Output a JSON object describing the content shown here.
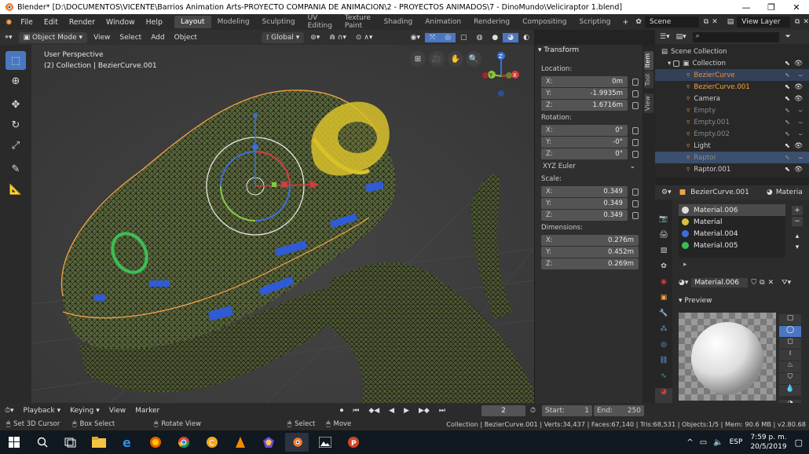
{
  "window": {
    "title": "Blender* [D:\\DOCUMENTOS\\VICENTE\\Barrios Animation Arts-PROYECTO COMPAÑIA DE ANIMACION\\2 - PROYECTOS ANIMADOS\\7 - DinoMundo\\Veliciraptor 1.blend]",
    "minimize": "—",
    "maximize": "❐",
    "close": "✕"
  },
  "menubar": {
    "items": [
      "File",
      "Edit",
      "Render",
      "Window",
      "Help"
    ],
    "workspaces": [
      "Layout",
      "Modeling",
      "Sculpting",
      "UV Editing",
      "Texture Paint",
      "Shading",
      "Animation",
      "Rendering",
      "Compositing",
      "Scripting"
    ],
    "add_workspace": "+",
    "scene_label": "Scene",
    "view_layer_label": "View Layer"
  },
  "header3d": {
    "mode": "Object Mode",
    "menus": [
      "View",
      "Select",
      "Add",
      "Object"
    ],
    "orientation": "Global"
  },
  "viewport": {
    "perspective": "User Perspective",
    "collection_info": "(2) Collection | BezierCurve.001",
    "gizmo_axes": {
      "z": "Z",
      "y": "Y",
      "x": "X"
    }
  },
  "npanel": {
    "header": "Transform",
    "location_label": "Location:",
    "location": [
      {
        "axis": "X:",
        "value": "0m"
      },
      {
        "axis": "Y:",
        "value": "-1.9935m"
      },
      {
        "axis": "Z:",
        "value": "1.6716m"
      }
    ],
    "rotation_label": "Rotation:",
    "rotation": [
      {
        "axis": "X:",
        "value": "0°"
      },
      {
        "axis": "Y:",
        "value": "-0°"
      },
      {
        "axis": "Z:",
        "value": "0°"
      }
    ],
    "rotation_mode": "XYZ Euler",
    "scale_label": "Scale:",
    "scale": [
      {
        "axis": "X:",
        "value": "0.349"
      },
      {
        "axis": "Y:",
        "value": "0.349"
      },
      {
        "axis": "Z:",
        "value": "0.349"
      }
    ],
    "dimensions_label": "Dimensions:",
    "dimensions": [
      {
        "axis": "X:",
        "value": "0.276m"
      },
      {
        "axis": "Y:",
        "value": "0.452m"
      },
      {
        "axis": "Z:",
        "value": "0.269m"
      }
    ],
    "tabs": [
      "Item",
      "Tool",
      "View"
    ]
  },
  "outliner": {
    "root": "Scene Collection",
    "collection": "Collection",
    "items": [
      {
        "name": "BezierCurve",
        "color": "#e8913a",
        "dim": true
      },
      {
        "name": "BezierCurve.001",
        "color": "#f5a345",
        "dim": false
      },
      {
        "name": "Camera",
        "color": "#cfcfcf",
        "dim": false
      },
      {
        "name": "Empty",
        "color": "#8a8a8a",
        "dim": true
      },
      {
        "name": "Empty.001",
        "color": "#8a8a8a",
        "dim": true
      },
      {
        "name": "Empty.002",
        "color": "#8a8a8a",
        "dim": true
      },
      {
        "name": "Light",
        "color": "#cfcfcf",
        "dim": false
      },
      {
        "name": "Raptor",
        "color": "#8a8a8a",
        "dim": true
      },
      {
        "name": "Raptor.001",
        "color": "#cfcfcf",
        "dim": false
      }
    ]
  },
  "properties": {
    "object_name": "BezierCurve.001",
    "tab_label": "Materia",
    "materials": [
      {
        "name": "Material.006",
        "color": "#dcdcdc"
      },
      {
        "name": "Material",
        "color": "#d8c23a"
      },
      {
        "name": "Material.004",
        "color": "#3b6fd8"
      },
      {
        "name": "Material.005",
        "color": "#3bbf55"
      }
    ],
    "active_material": "Material.006",
    "preview_label": "Preview"
  },
  "timeline": {
    "menus": [
      "Playback",
      "Keying",
      "View",
      "Marker"
    ],
    "current_frame": "2",
    "start_label": "Start:",
    "start": "1",
    "end_label": "End:",
    "end": "250"
  },
  "statusbar": {
    "hints": [
      "Set 3D Cursor",
      "Box Select",
      "Rotate View",
      "Select",
      "Move"
    ],
    "stats": "Collection | BezierCurve.001 | Verts:34,437 | Faces:67,140 | Tris:68,531 | Objects:1/5 | Mem: 90.6 MB | v2.80.68"
  },
  "taskbar": {
    "lang": "ESP",
    "time": "7:59 p. m.",
    "date": "20/5/2019"
  },
  "colors": {
    "accent_blue": "#4b77c2",
    "selection_orange": "#f5a345",
    "mesh_wire": "#111111",
    "mesh_fill": "#5d6b3c"
  }
}
